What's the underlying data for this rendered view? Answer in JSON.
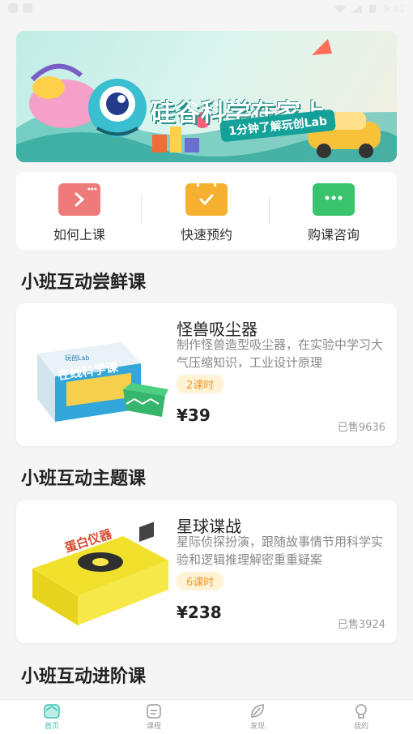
{
  "status": {
    "time": "9:41"
  },
  "banner": {
    "title": "硅谷科学在家上",
    "subtitle": "1分钟了解玩创Lab"
  },
  "quick_actions": [
    {
      "label": "如何上课",
      "icon": "play-video-icon",
      "color": "#ef7a7a"
    },
    {
      "label": "快速预约",
      "icon": "calendar-check-icon",
      "color": "#f5b12f"
    },
    {
      "label": "购课咨询",
      "icon": "chat-bubble-icon",
      "color": "#39c36c"
    }
  ],
  "sections": [
    {
      "title": "小班互动尝鲜课"
    },
    {
      "title": "小班互动主题课"
    },
    {
      "title": "小班互动进阶课"
    }
  ],
  "courses": [
    {
      "title": "怪兽吸尘器",
      "desc": "制作怪兽造型吸尘器，在实验中学习大气压缩知识，工业设计原理",
      "badge": "2课时",
      "price": "¥39",
      "sold": "已售9636"
    },
    {
      "title": "星球谍战",
      "desc": "星际侦探扮演，跟随故事情节用科学实验和逻辑推理解密重重疑案",
      "badge": "6课时",
      "price": "¥238",
      "sold": "已售3924"
    }
  ],
  "box_texts": {
    "box1_brand": "玩创Lab",
    "box1_title": "在线科学课",
    "box2_title": "蛋白仪器"
  },
  "tabs": [
    {
      "label": "首页",
      "icon": "home-icon",
      "active": true
    },
    {
      "label": "课程",
      "icon": "course-icon",
      "active": false
    },
    {
      "label": "发现",
      "icon": "discover-icon",
      "active": false
    },
    {
      "label": "我的",
      "icon": "profile-icon",
      "active": false
    }
  ],
  "colors": {
    "accent": "#3cc3b4",
    "badge_text": "#f39a2c",
    "badge_bg": "#fff3d6"
  }
}
